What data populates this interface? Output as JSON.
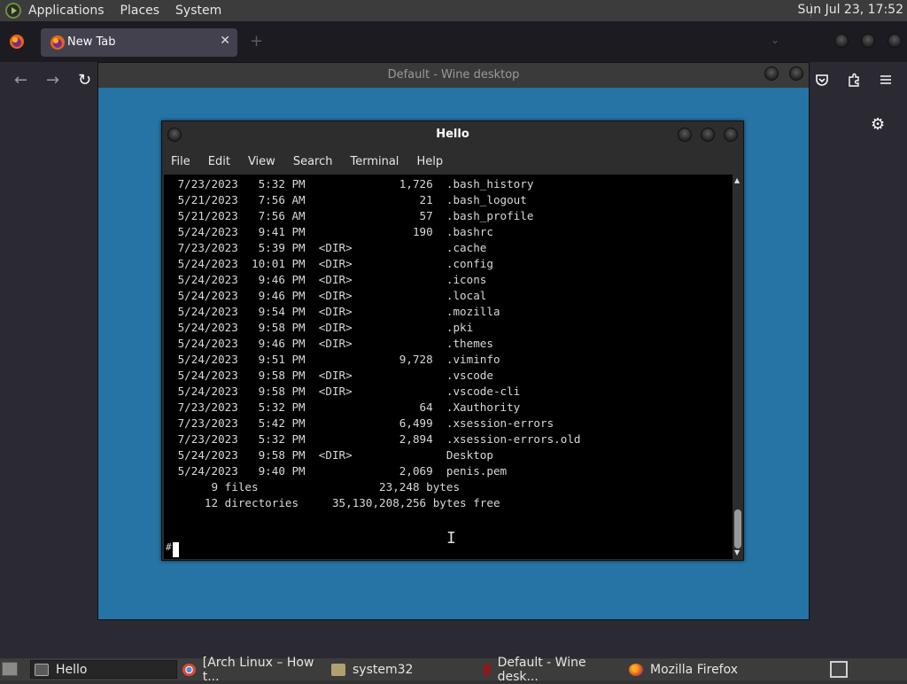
{
  "top_panel": {
    "menus": [
      "Applications",
      "Places",
      "System"
    ],
    "clock": "Sun Jul 23, 17:52"
  },
  "firefox": {
    "tab_label": "New Tab",
    "tab_close": "✕",
    "new_tab": "+",
    "list_all_tabs": "⌄",
    "nav": {
      "back": "←",
      "forward": "→",
      "reload": "↻"
    },
    "toolbar_icons": [
      "pocket-icon",
      "extensions-icon",
      "menu-icon"
    ],
    "gear": "⚙"
  },
  "wine": {
    "title": "Default - Wine desktop"
  },
  "hello": {
    "title": "Hello",
    "menu": [
      "File",
      "Edit",
      "View",
      "Search",
      "Terminal",
      "Help"
    ],
    "listing": [
      {
        "date": "7/23/2023",
        "time": "5:32 PM",
        "dir": "",
        "size": "1,726",
        "name": ".bash_history"
      },
      {
        "date": "5/21/2023",
        "time": "7:56 AM",
        "dir": "",
        "size": "21",
        "name": ".bash_logout"
      },
      {
        "date": "5/21/2023",
        "time": "7:56 AM",
        "dir": "",
        "size": "57",
        "name": ".bash_profile"
      },
      {
        "date": "5/24/2023",
        "time": "9:41 PM",
        "dir": "",
        "size": "190",
        "name": ".bashrc"
      },
      {
        "date": "7/23/2023",
        "time": "5:39 PM",
        "dir": "<DIR>",
        "size": "",
        "name": ".cache"
      },
      {
        "date": "5/24/2023",
        "time": "10:01 PM",
        "dir": "<DIR>",
        "size": "",
        "name": ".config"
      },
      {
        "date": "5/24/2023",
        "time": "9:46 PM",
        "dir": "<DIR>",
        "size": "",
        "name": ".icons"
      },
      {
        "date": "5/24/2023",
        "time": "9:46 PM",
        "dir": "<DIR>",
        "size": "",
        "name": ".local"
      },
      {
        "date": "5/24/2023",
        "time": "9:54 PM",
        "dir": "<DIR>",
        "size": "",
        "name": ".mozilla"
      },
      {
        "date": "5/24/2023",
        "time": "9:58 PM",
        "dir": "<DIR>",
        "size": "",
        "name": ".pki"
      },
      {
        "date": "5/24/2023",
        "time": "9:46 PM",
        "dir": "<DIR>",
        "size": "",
        "name": ".themes"
      },
      {
        "date": "5/24/2023",
        "time": "9:51 PM",
        "dir": "",
        "size": "9,728",
        "name": ".viminfo"
      },
      {
        "date": "5/24/2023",
        "time": "9:58 PM",
        "dir": "<DIR>",
        "size": "",
        "name": ".vscode"
      },
      {
        "date": "5/24/2023",
        "time": "9:58 PM",
        "dir": "<DIR>",
        "size": "",
        "name": ".vscode-cli"
      },
      {
        "date": "7/23/2023",
        "time": "5:32 PM",
        "dir": "",
        "size": "64",
        "name": ".Xauthority"
      },
      {
        "date": "7/23/2023",
        "time": "5:42 PM",
        "dir": "",
        "size": "6,499",
        "name": ".xsession-errors"
      },
      {
        "date": "7/23/2023",
        "time": "5:32 PM",
        "dir": "",
        "size": "2,894",
        "name": ".xsession-errors.old"
      },
      {
        "date": "5/24/2023",
        "time": "9:58 PM",
        "dir": "<DIR>",
        "size": "",
        "name": "Desktop"
      },
      {
        "date": "5/24/2023",
        "time": "9:40 PM",
        "dir": "",
        "size": "2,069",
        "name": "penis.pem"
      }
    ],
    "summary_files": "9 files",
    "summary_files_bytes": "23,248 bytes",
    "summary_dirs": "12 directories",
    "summary_dirs_bytes": "35,130,208,256 bytes free",
    "prompt": "#"
  },
  "taskbar": {
    "items": [
      {
        "label": "Hello",
        "icon": "terminal-icon",
        "color": "#5a5a5a"
      },
      {
        "label": "[Arch Linux – How t...",
        "icon": "chromium-icon",
        "color": "#4a8fd8"
      },
      {
        "label": "system32",
        "icon": "folder-icon",
        "color": "#b0a070"
      },
      {
        "label": "Default - Wine desk...",
        "icon": "wine-icon",
        "color": "#8b1a1a"
      },
      {
        "label": "Mozilla Firefox",
        "icon": "firefox-icon",
        "color": "#e8641a"
      }
    ]
  }
}
